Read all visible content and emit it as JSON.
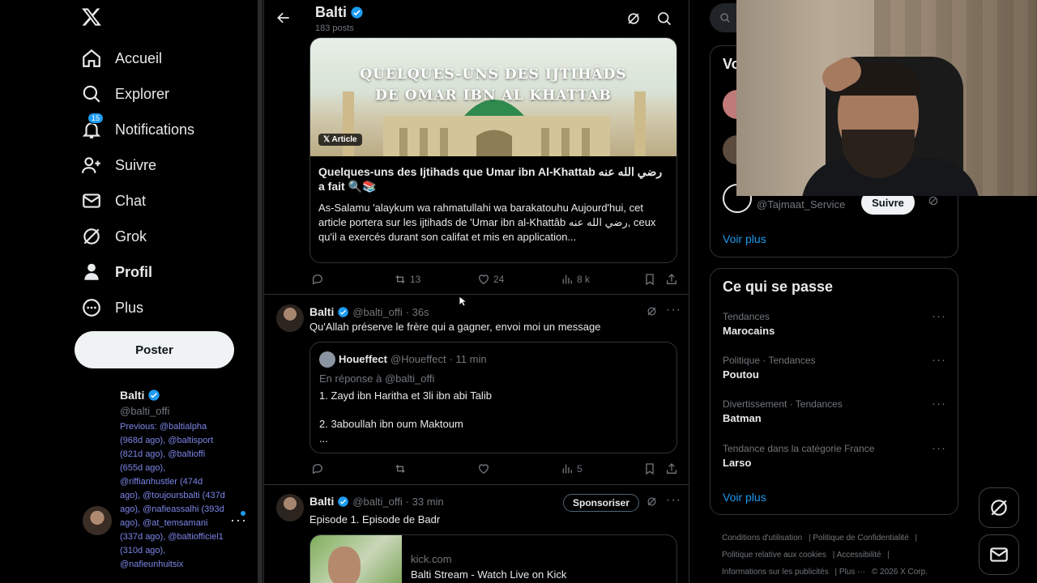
{
  "nav": {
    "items": [
      {
        "label": "Accueil",
        "icon": "home-icon"
      },
      {
        "label": "Explorer",
        "icon": "search-icon"
      },
      {
        "label": "Notifications",
        "icon": "bell-icon",
        "badge": "15"
      },
      {
        "label": "Suivre",
        "icon": "add-user-icon"
      },
      {
        "label": "Chat",
        "icon": "mail-icon"
      },
      {
        "label": "Grok",
        "icon": "grok-icon"
      },
      {
        "label": "Profil",
        "icon": "profile-icon"
      },
      {
        "label": "Plus",
        "icon": "more-circle-icon"
      }
    ],
    "post_label": "Poster"
  },
  "account": {
    "name": "Balti",
    "handle": "@balti_offi",
    "previous": "Previous: @baltialpha (968d ago), @baltisport (821d ago), @baltioffi (655d ago), @riffianhustler (474d ago), @toujoursbalti (437d ago), @nafieassalhi (393d ago), @at_temsamani (337d ago), @baltiofficiel1 (310d ago), @nafieunhuitsix"
  },
  "header": {
    "name": "Balti",
    "posts": "183 posts"
  },
  "article": {
    "image_title_line1": "QUELQUES-UNS DES IJTIHÂDS",
    "image_title_line2": "DE OMAR IBN AL KHATTAB",
    "tag": "Article",
    "title": "Quelques-uns des Ijtihads que Umar ibn Al-Khattab رضي الله عنه  a fait 🔍📚",
    "desc": "As-Salamu 'alaykum wa rahmatullahi wa barakatouhu Aujourd'hui, cet article portera sur les ijtihads de 'Umar ibn al-Khattâb رضي الله عنه, ceux qu'il a exercés durant son califat et mis en application...",
    "retweets": "13",
    "likes": "24",
    "views": "8 k"
  },
  "tweet1": {
    "name": "Balti",
    "handle": "@balti_offi",
    "time": "· 36s",
    "text": "Qu'Allah préserve le frère qui a gagner, envoi moi un message",
    "views": "5",
    "quote": {
      "name": "Houeffect",
      "handle": "@Houeffect",
      "time": "· 11 min",
      "reply_to": "En réponse à @balti_offi",
      "line1": "1. Zayd ibn Haritha et 3li ibn abi Talib",
      "line2": "2. 3aboullah ibn oum Maktoum",
      "line3": "..."
    }
  },
  "tweet2": {
    "name": "Balti",
    "handle": "@balti_offi",
    "time": "· 33 min",
    "sponsor_label": "Sponsoriser",
    "text": "Episode 1. Episode de Badr",
    "link_domain": "kick.com",
    "link_title": "Balti Stream - Watch Live on Kick"
  },
  "right": {
    "who_title": "Vo",
    "who_handle": "@Tajmaat_Service",
    "follow_label": "Suivre",
    "see_more": "Voir plus",
    "trends_title": "Ce qui se passe",
    "trends": [
      {
        "meta": "Tendances",
        "name": "Marocains"
      },
      {
        "meta": "Politique · Tendances",
        "name": "Poutou"
      },
      {
        "meta": "Divertissement · Tendances",
        "name": "Batman"
      },
      {
        "meta": "Tendance dans la catégorie France",
        "name": "Larso"
      }
    ],
    "trends_more": "Voir plus",
    "footer": {
      "terms": "Conditions d'utilisation",
      "privacy": "Politique de Confidentialité",
      "cookies": "Politique relative aux cookies",
      "access": "Accessibilité",
      "ads": "Informations sur les publicités",
      "more": "Plus ···",
      "copyright": "© 2026 X Corp."
    }
  },
  "colors": {
    "accent": "#1d9bf0",
    "background": "#000000",
    "text": "#e7e9ea",
    "muted": "#71767b"
  }
}
